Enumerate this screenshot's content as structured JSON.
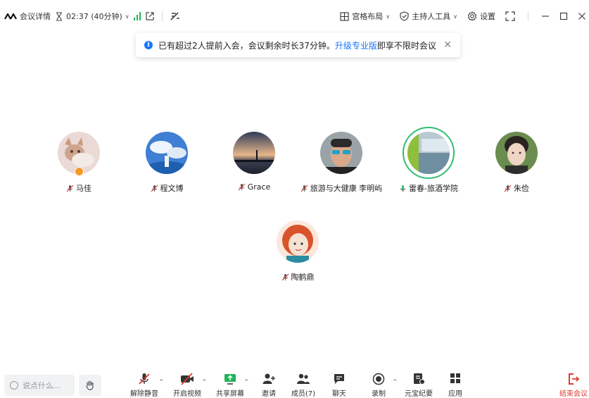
{
  "topbar": {
    "meeting_details": "会议详情",
    "timer": "02:37 (40分钟)",
    "layout": "宫格布局",
    "host_tools": "主持人工具",
    "settings": "设置"
  },
  "notice": {
    "text_before": "已有超过2人提前入会，会议剩余时长37分钟。",
    "link": "升级专业版",
    "text_after": "即享不限时会议"
  },
  "participants": [
    {
      "name": "马佳"
    },
    {
      "name": "程文博"
    },
    {
      "name": "Grace"
    },
    {
      "name": "旅游与大健康 李明屿"
    },
    {
      "name": "雷春-旅酒学院"
    },
    {
      "name": "朱俭"
    },
    {
      "name": "陶鹤鼎"
    }
  ],
  "toolbar": {
    "say_placeholder": "说点什么...",
    "unmute": "解除静音",
    "start_video": "开启视频",
    "share_screen": "共享屏幕",
    "invite": "邀请",
    "members": "成员(7)",
    "chat": "聊天",
    "record": "录制",
    "minutes": "元宝纪要",
    "apps": "应用",
    "end": "结束会议"
  },
  "colors": {
    "accent": "#1677ff",
    "signal_green": "#1fb45a",
    "active_speaker": "#2fbf71",
    "end_red": "#e03b2f",
    "host_badge": "#f59a23"
  }
}
